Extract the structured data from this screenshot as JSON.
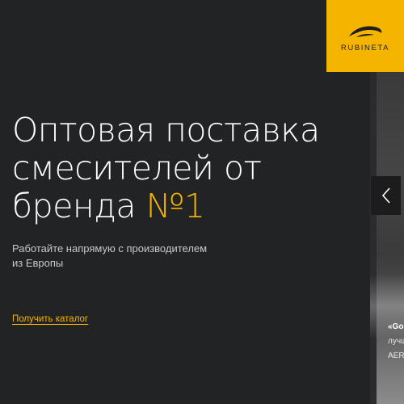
{
  "brand": {
    "name": "RUBINETA",
    "accent_color": "#f5b400",
    "background_color": "#222325"
  },
  "hero": {
    "title_lines": [
      "Оптовая поставка",
      "смесителей от",
      "бренда "
    ],
    "title_accent": "№1",
    "subtitle_lines": [
      "Работайте напрямую с производителем",
      "из Европы"
    ],
    "cta_label": "Получить каталог"
  },
  "slider": {
    "prev_icon": "chevron-left-icon",
    "caption_title": "«Go",
    "caption_lines": [
      "лучш",
      "AERO"
    ]
  }
}
